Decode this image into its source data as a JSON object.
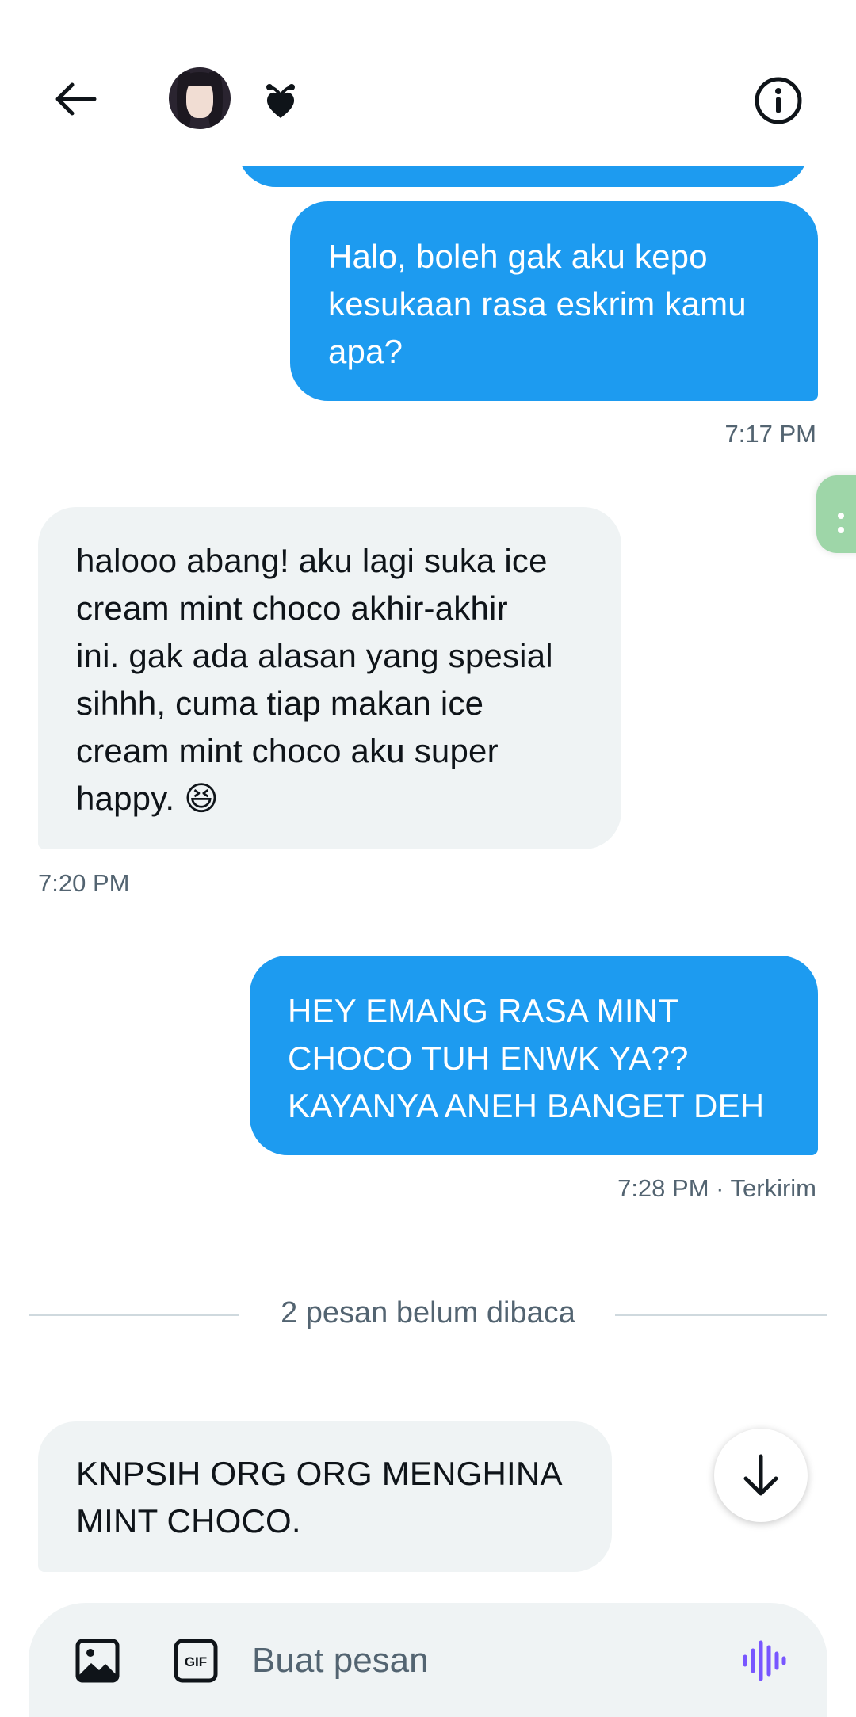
{
  "header": {
    "name_emoji": "❦"
  },
  "messages": [
    {
      "direction": "sent",
      "text": "Halo, boleh gak aku kepo\nkesukaan rasa eskrim kamu\napa?",
      "timestamp": "7:17 PM"
    },
    {
      "direction": "received",
      "text": "halooo abang! aku lagi suka ice\ncream mint choco akhir-akhir\nini. gak ada alasan yang spesial\nsihhh, cuma tiap makan ice\ncream mint choco aku super\nhappy. 😆",
      "timestamp": "7:20 PM"
    },
    {
      "direction": "sent",
      "text": "HEY EMANG RASA MINT\nCHOCO TUH ENWK YA??\nKAYANYA ANEH BANGET DEH",
      "timestamp": "7:28 PM · Terkirim"
    },
    {
      "direction": "received",
      "text": "KNPSIH ORG ORG MENGHINA\nMINT CHOCO.",
      "timestamp": ""
    }
  ],
  "unread_divider": "2 pesan belum dibaca",
  "composer": {
    "placeholder": "Buat pesan",
    "value": ""
  },
  "colors": {
    "sent_bubble": "#1d9bf0",
    "received_bubble": "#eff3f4",
    "voice_icon": "#7856ff",
    "side_tab": "#9ed6a8"
  },
  "icons": [
    "back-arrow-icon",
    "info-icon",
    "scroll-down-arrow-icon",
    "image-icon",
    "gif-icon",
    "voice-waveform-icon"
  ]
}
